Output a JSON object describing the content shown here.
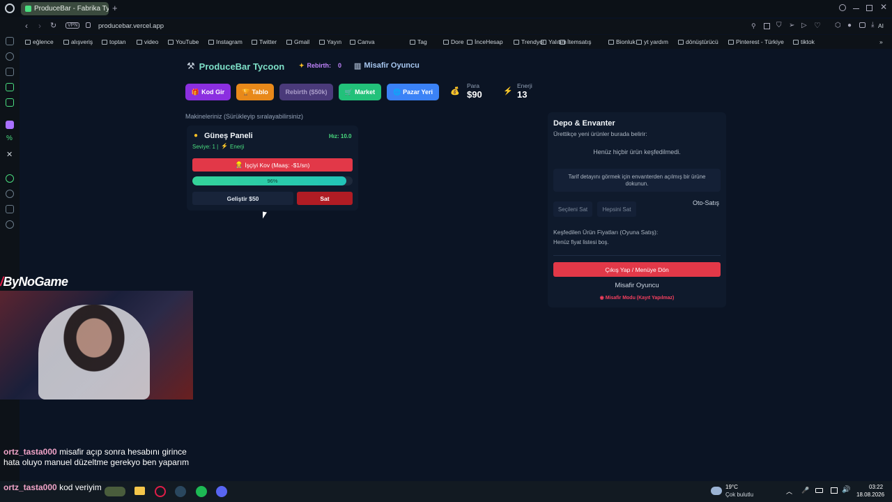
{
  "browser": {
    "tab_title": "ProduceBar - Fabrika Tycoo",
    "url": "producebar.vercel.app",
    "vpn_label": "VPN",
    "ai_label": "AI",
    "bookmarks": [
      "eğlence",
      "alışveriş",
      "toptan",
      "video",
      "YouTube",
      "Instagram",
      "Twitter",
      "Gmail",
      "Yayın",
      "Canva",
      "Tag",
      "Dore",
      "İnceHesap",
      "Trendyol",
      "Yalıtım",
      "İtemsatış",
      "Bionluk",
      "yt yardım",
      "dönüştürücü",
      "Pinterest - Türkiye",
      "tiktok"
    ]
  },
  "app": {
    "title": "ProduceBar Tycoon",
    "rebirth_label": "Rebirth:",
    "rebirth_value": "0",
    "player": "Misafir Oyuncu",
    "buttons": {
      "kod": "Kod Gir",
      "tablo": "Tablo",
      "rebirth": "Rebirth ($50k)",
      "market": "Market",
      "pazar": "Pazar Yeri"
    },
    "para_label": "Para",
    "para_value": "$90",
    "enerji_label": "Enerji",
    "enerji_value": "13",
    "machines_heading": "Makineleriniz (Sürükleyip sıralayabilirsiniz)",
    "machine": {
      "name": "Güneş Paneli",
      "speed": "Hız: 10.0",
      "level": "Seviye: 1 |",
      "type": "Enerji",
      "fire_worker": "İşçiyi Kov (Maaş: -$1/sn)",
      "progress_text": "96%",
      "progress": 0.96,
      "upgrade": "Geliştir $50",
      "sell": "Sat"
    },
    "depo": {
      "title": "Depo & Envanter",
      "subtitle": "Ürettikçe yeni ürünler burada belirir:",
      "empty": "Henüz hiçbir ürün keşfedilmedi.",
      "recipe_hint": "Tarif detayını görmek için envanterden açılmış bir ürüne dokunun.",
      "sell_selected": "Seçileni Sat",
      "sell_all": "Hepsini Sat",
      "auto_sell": "Oto-Satış",
      "prices_title": "Keşfedilen Ürün Fiyatları (Oyuna Satış):",
      "prices_empty": "Henüz fiyat listesi boş.",
      "logout": "Çıkış Yap / Menüye Dön",
      "guest": "Misafir Oyuncu",
      "guest_mode": "Misafir Modu (Kayıt Yapılmaz)"
    }
  },
  "overlay": {
    "channel": "ByNoGame",
    "chat": [
      {
        "user": "ortz_tasta000",
        "text": "misafir açıp sonra hesabını girince hata oluyo manuel düzeltme gerekyo ben yaparım"
      },
      {
        "user": "ortz_tasta000",
        "text": "kod veriyim"
      }
    ]
  },
  "taskbar": {
    "temp": "19°C",
    "weather": "Çok bulutlu",
    "time": "03:22",
    "date": "18.08.2026"
  },
  "colors": {
    "kod": "#8b2fe0",
    "tablo": "#e8891a",
    "rebirth": "#4a3a7a",
    "market": "#22c17a",
    "pazar": "#3b82f6",
    "fire": "#e23848",
    "progress": "#2dd4b4",
    "sell": "#b01c24",
    "logout": "#e23848",
    "title": "#7ee0c8"
  }
}
